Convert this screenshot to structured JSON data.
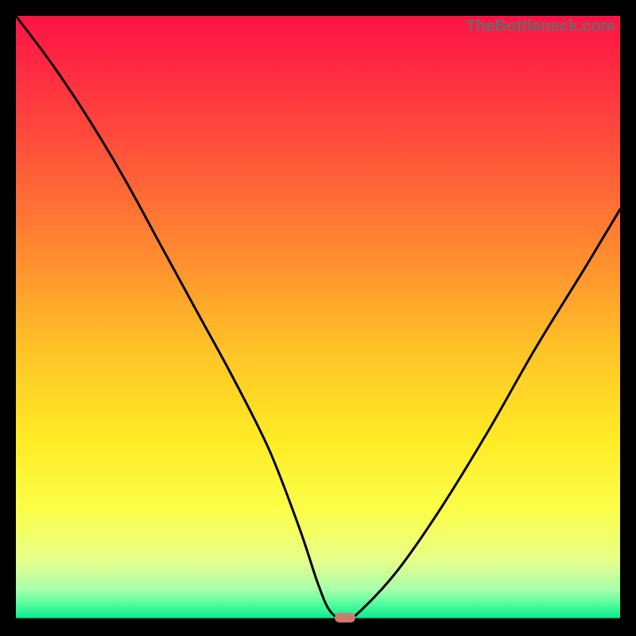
{
  "watermark": "TheBottleneck.com",
  "chart_data": {
    "type": "line",
    "title": "",
    "xlabel": "",
    "ylabel": "",
    "xlim": [
      0,
      100
    ],
    "ylim": [
      0,
      100
    ],
    "grid": false,
    "legend": false,
    "series": [
      {
        "name": "curve",
        "x": [
          0,
          6,
          12,
          18,
          24,
          30,
          36,
          42,
          47,
          50,
          52,
          54.5,
          57,
          63,
          70,
          78,
          86,
          94,
          100
        ],
        "y": [
          100,
          92,
          83,
          73,
          62,
          51,
          40,
          28,
          15,
          6,
          1.5,
          0,
          1.5,
          8,
          18,
          31,
          45,
          58,
          68
        ]
      }
    ],
    "minimum_marker": {
      "x": 54.5,
      "y": 0
    },
    "background_gradient": {
      "stops": [
        {
          "pos": 0.0,
          "color": "#ff1246"
        },
        {
          "pos": 0.2,
          "color": "#ff4b3c"
        },
        {
          "pos": 0.4,
          "color": "#ff8d2f"
        },
        {
          "pos": 0.55,
          "color": "#ffc227"
        },
        {
          "pos": 0.7,
          "color": "#ffeb25"
        },
        {
          "pos": 0.82,
          "color": "#fbff4a"
        },
        {
          "pos": 0.9,
          "color": "#e8ff8a"
        },
        {
          "pos": 0.95,
          "color": "#a8ffab"
        },
        {
          "pos": 0.975,
          "color": "#4efc9d"
        },
        {
          "pos": 1.0,
          "color": "#00e88e"
        }
      ]
    }
  }
}
